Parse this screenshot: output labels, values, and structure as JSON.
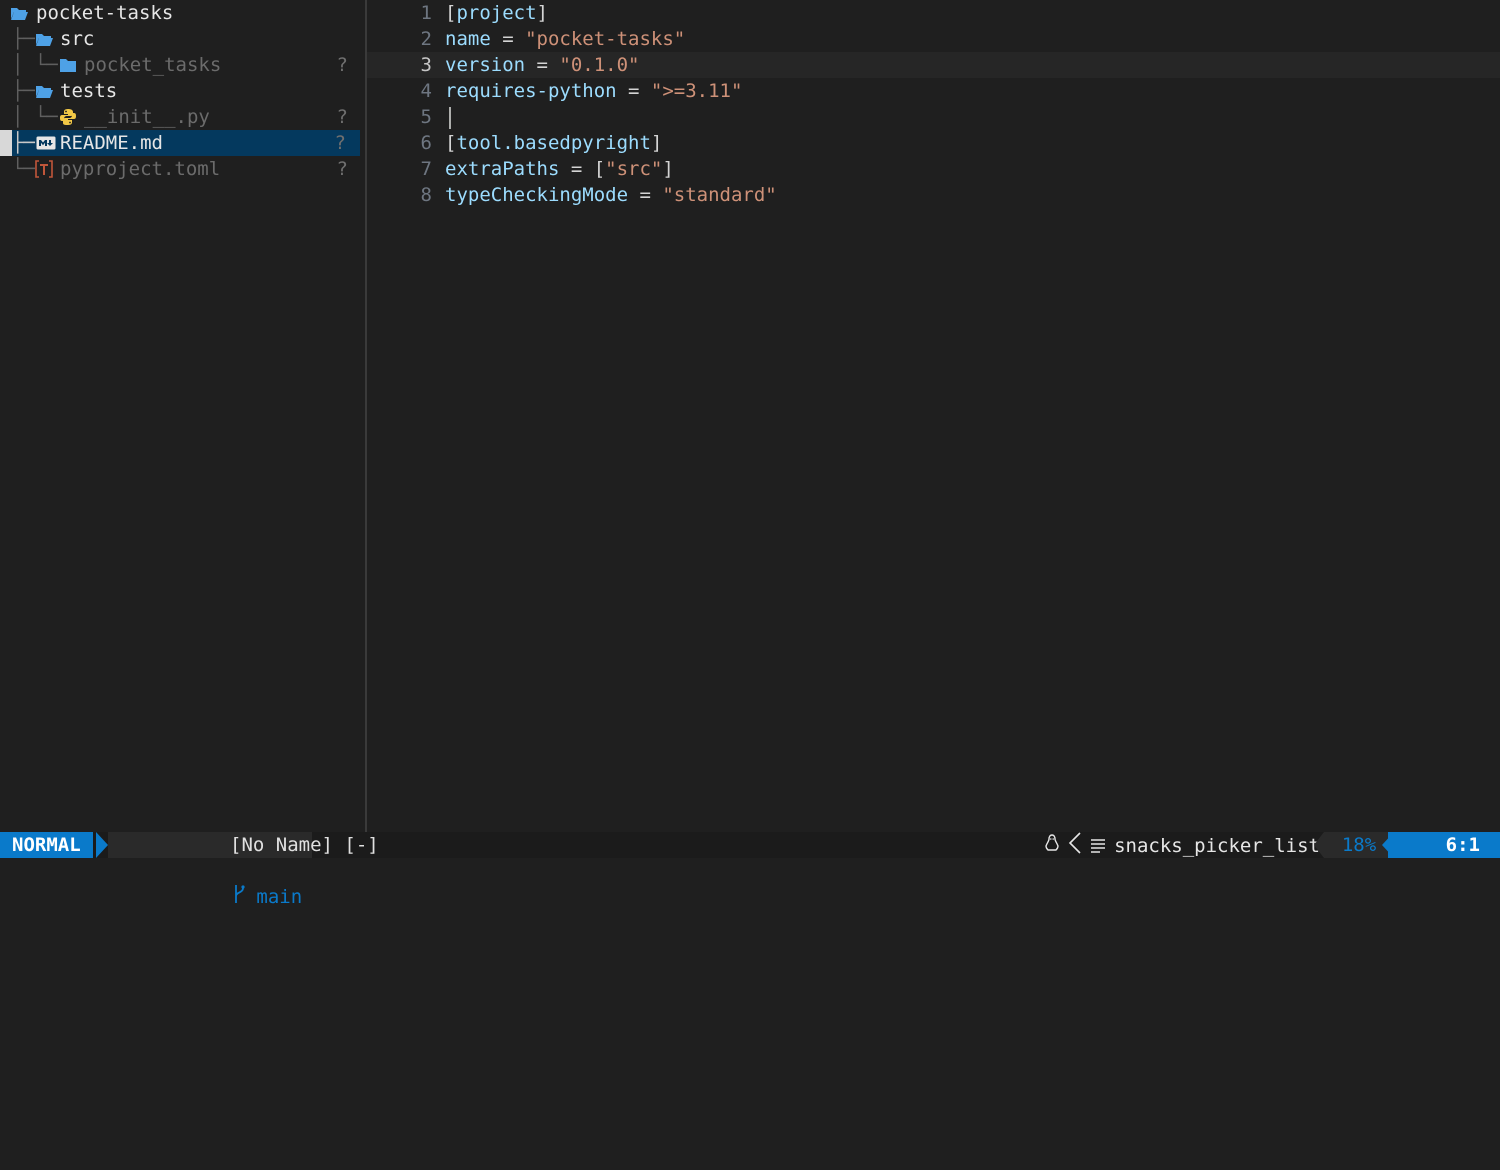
{
  "explorer": {
    "root": "pocket-tasks",
    "items": [
      {
        "name": "src",
        "status": ""
      },
      {
        "name": "pocket_tasks",
        "status": "?"
      },
      {
        "name": "tests",
        "status": ""
      },
      {
        "name": "__init__.py",
        "status": "?"
      },
      {
        "name": "README.md",
        "status": "?"
      },
      {
        "name": "pyproject.toml",
        "status": "?"
      }
    ]
  },
  "editor": {
    "lines": [
      {
        "num": "1",
        "parts": [
          [
            "p",
            "["
          ],
          [
            "k",
            "project"
          ],
          [
            "p",
            "]"
          ]
        ]
      },
      {
        "num": "2",
        "parts": [
          [
            "k",
            "name"
          ],
          [
            "p",
            " = "
          ],
          [
            "s",
            "\"pocket-tasks\""
          ]
        ]
      },
      {
        "num": "3",
        "parts": [
          [
            "k",
            "version"
          ],
          [
            "p",
            " = "
          ],
          [
            "s",
            "\"0.1.0\""
          ]
        ]
      },
      {
        "num": "4",
        "parts": [
          [
            "k",
            "requires-python"
          ],
          [
            "p",
            " = "
          ],
          [
            "s",
            "\">=3.11\""
          ]
        ]
      },
      {
        "num": "5",
        "parts": []
      },
      {
        "num": "6",
        "parts": [
          [
            "p",
            "["
          ],
          [
            "k",
            "tool.basedpyright"
          ],
          [
            "p",
            "]"
          ]
        ]
      },
      {
        "num": "7",
        "parts": [
          [
            "k",
            "extraPaths"
          ],
          [
            "p",
            " = ["
          ],
          [
            "s",
            "\"src\""
          ],
          [
            "p",
            "]"
          ]
        ]
      },
      {
        "num": "8",
        "parts": [
          [
            "k",
            "typeCheckingMode"
          ],
          [
            "p",
            " = "
          ],
          [
            "s",
            "\"standard\""
          ]
        ]
      }
    ]
  },
  "statusline": {
    "mode": "NORMAL",
    "branch": "main",
    "filename": "[No Name] [-]",
    "filetype": "snacks_picker_list",
    "percent": "18%",
    "position": "6:1"
  },
  "colors": {
    "accent": "#0a7aca",
    "folder": "#4ea1e6",
    "python": "#f3c846",
    "toml": "#c0563a",
    "string": "#ce9178",
    "keyword": "#9cdcfe"
  },
  "icons": {
    "folder": "folder-open-icon",
    "folder_closed": "folder-icon",
    "python": "python-icon",
    "markdown": "markdown-icon",
    "toml": "toml-icon",
    "branch": "git-branch-icon",
    "os": "linux-icon",
    "filetype": "text-lines-icon"
  }
}
